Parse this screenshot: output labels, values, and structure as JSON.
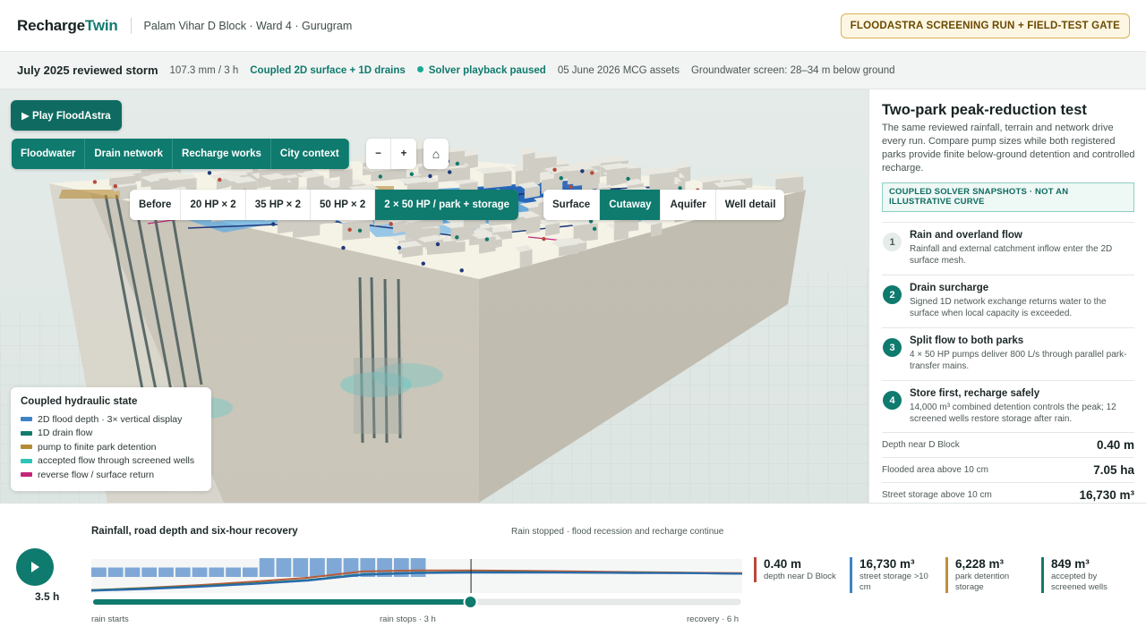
{
  "header": {
    "logo_a": "Recharge",
    "logo_b": "Twin",
    "breadcrumb": "Palam Vihar D Block · Ward 4 · Gurugram",
    "gate_badge": "FLOODASTRA SCREENING RUN + FIELD-TEST GATE"
  },
  "status": {
    "storm": "July 2025 reviewed storm",
    "rain": "107.3 mm / 3 h",
    "model": "Coupled 2D surface + 1D drains",
    "playback": "Solver playback paused",
    "assets": "05 June 2026 MCG assets",
    "groundwater": "Groundwater screen: 28–34 m below ground"
  },
  "toolbar": {
    "play_label": "▶ Play FloodAstra",
    "scenarios": [
      "Before",
      "20 HP × 2",
      "35 HP × 2",
      "50 HP × 2",
      "2 × 50 HP / park + storage"
    ],
    "views": [
      "Surface",
      "Cutaway",
      "Aquifer",
      "Well detail"
    ],
    "layers": [
      "Floodwater",
      "Drain network",
      "Recharge works",
      "City context"
    ],
    "zoom_out": "−",
    "zoom_in": "+",
    "home_icon": "⌂"
  },
  "legend": {
    "title": "Coupled hydraulic state",
    "items": [
      {
        "label": "2D flood depth · 3× vertical display",
        "color": "#3d84c4"
      },
      {
        "label": "1D drain flow",
        "color": "#127a6a"
      },
      {
        "label": "pump to finite park detention",
        "color": "#b58a35"
      },
      {
        "label": "accepted flow through screened wells",
        "color": "#2ec4b6"
      },
      {
        "label": "reverse flow / surface return",
        "color": "#c2287a"
      }
    ]
  },
  "panel": {
    "title": "Two-park peak-reduction test",
    "description": "The same reviewed rainfall, terrain and network drive every run. Compare pump sizes while both registered parks provide finite below-ground detention and controlled recharge.",
    "tag": "COUPLED SOLVER SNAPSHOTS · NOT AN ILLUSTRATIVE CURVE",
    "steps": [
      {
        "n": "1",
        "title": "Rain and overland flow",
        "desc": "Rainfall and external catchment inflow enter the 2D surface mesh."
      },
      {
        "n": "2",
        "title": "Drain surcharge",
        "desc": "Signed 1D network exchange returns water to the surface when local capacity is exceeded."
      },
      {
        "n": "3",
        "title": "Split flow to both parks",
        "desc": "4 × 50 HP pumps deliver 800 L/s through parallel park-transfer mains."
      },
      {
        "n": "4",
        "title": "Store first, recharge safely",
        "desc": "14,000 m³ combined detention controls the peak; 12 screened wells restore storage after rain."
      }
    ],
    "metrics": [
      {
        "label": "Depth near D Block",
        "value": "0.40 m"
      },
      {
        "label": "Flooded area above 10 cm",
        "value": "7.05 ha"
      },
      {
        "label": "Street storage above 10 cm",
        "value": "16,730 m³"
      }
    ]
  },
  "timeline": {
    "current_time": "3.5 h",
    "title": "Rainfall, road depth and six-hour recovery",
    "note": "Rain stopped · flood recession and recharge continue",
    "tick_start": "rain starts",
    "tick_mid": "rain stops · 3 h",
    "tick_end": "recovery · 6 h",
    "progress": 0.583
  },
  "chart_data": {
    "type": "area",
    "title": "Rainfall, road depth and six-hour recovery",
    "x_range_hours": [
      0,
      6
    ],
    "rain_bars": [
      0.35,
      0.35,
      0.35,
      0.35,
      0.35,
      0.35,
      0.35,
      0.35,
      0.35,
      0.35,
      0.7,
      0.7,
      0.7,
      0.7,
      0.7,
      0.7,
      0.7,
      0.7,
      0.7,
      0.7
    ],
    "series": [
      {
        "color": "#b85a3c",
        "values": [
          0.05,
          0.09,
          0.14,
          0.2,
          0.27,
          0.38,
          0.4,
          0.4,
          0.39,
          0.38,
          0.37,
          0.36,
          0.35
        ]
      },
      {
        "color": "#127a6a",
        "values": [
          0.05,
          0.08,
          0.12,
          0.17,
          0.23,
          0.33,
          0.36,
          0.37,
          0.37,
          0.36,
          0.36,
          0.35,
          0.34
        ]
      },
      {
        "color": "#2a6ab0",
        "values": [
          0.04,
          0.07,
          0.11,
          0.16,
          0.22,
          0.32,
          0.35,
          0.36,
          0.36,
          0.36,
          0.35,
          0.35,
          0.34
        ]
      }
    ],
    "cursor_hours": 3.5
  },
  "kpis": [
    {
      "value": "0.40 m",
      "label": "depth near D Block",
      "color": "#b84a3a"
    },
    {
      "value": "16,730 m³",
      "label": "street storage >10 cm",
      "color": "#3d84c4"
    },
    {
      "value": "6,228 m³",
      "label": "park detention storage",
      "color": "#c0903a"
    },
    {
      "value": "849 m³",
      "label": "accepted by screened wells",
      "color": "#127a6a"
    }
  ]
}
